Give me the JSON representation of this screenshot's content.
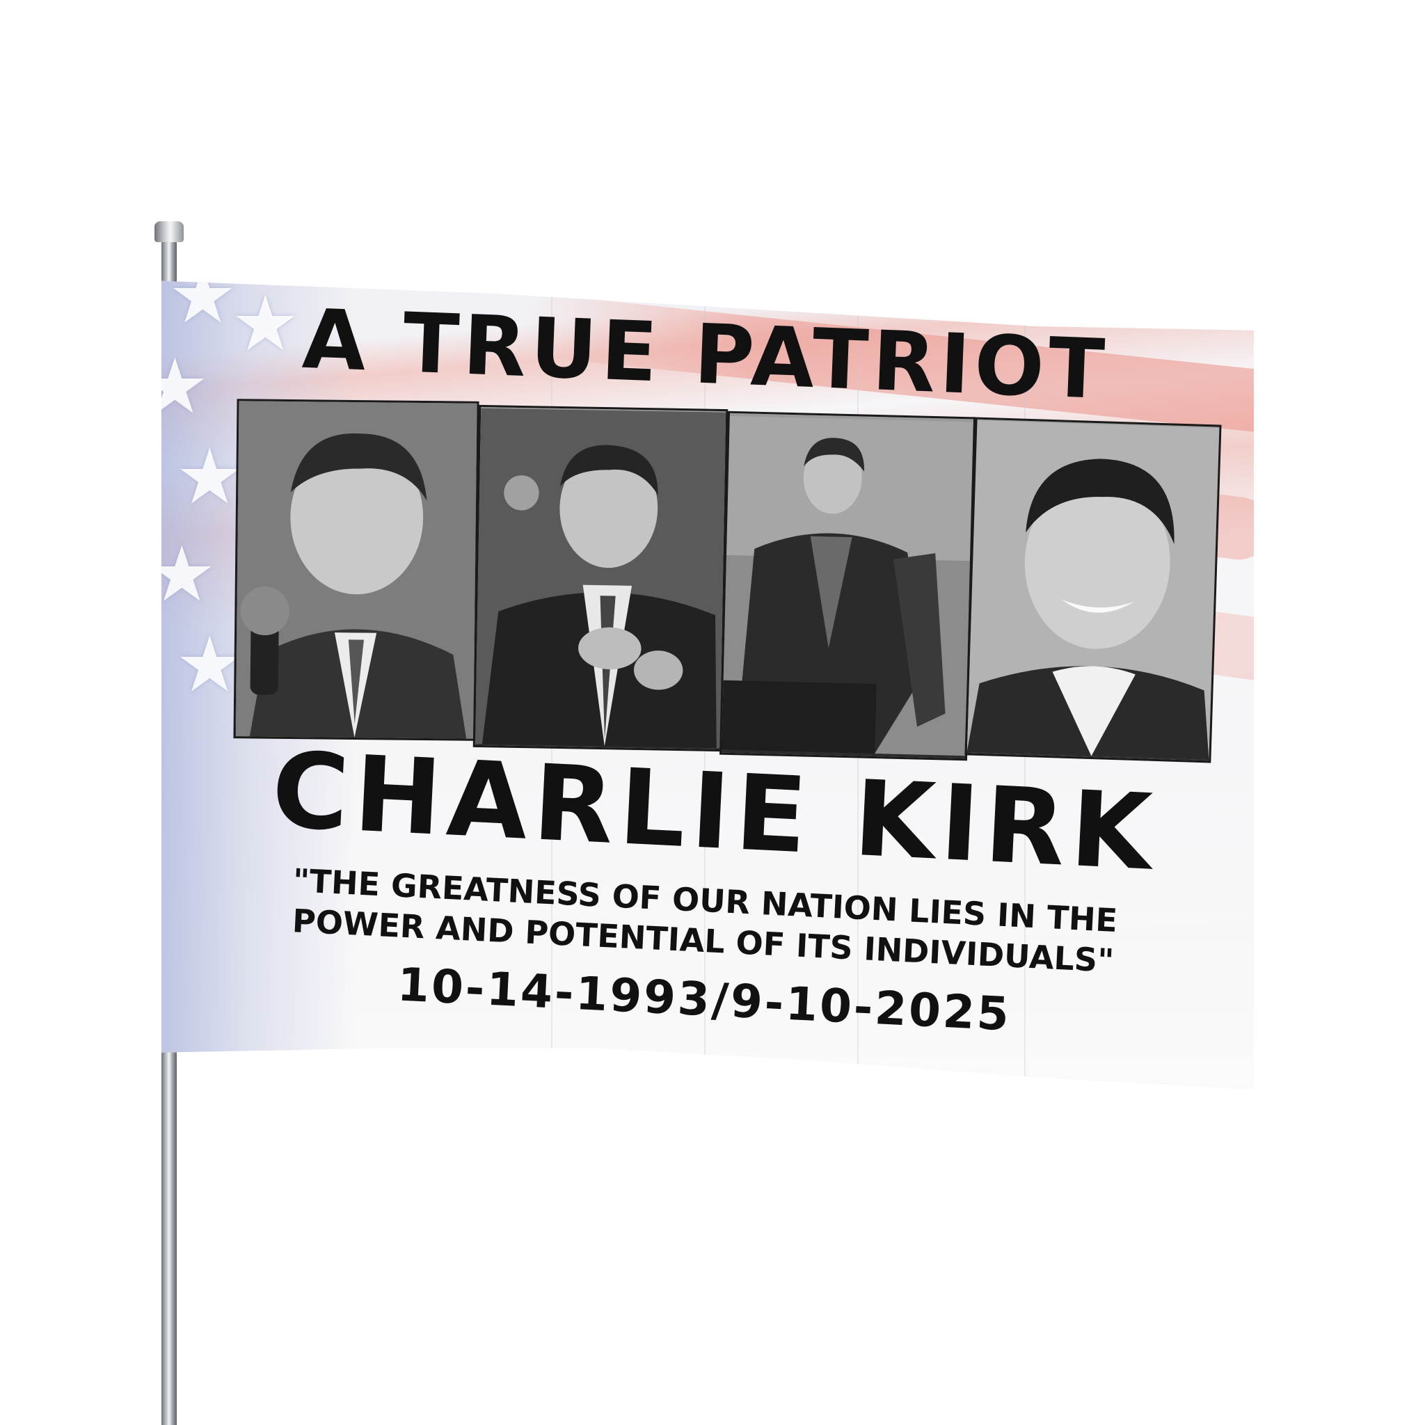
{
  "flag": {
    "title": "A TRUE PATRIOT",
    "name": "CHARLIE KIRK",
    "quote_line1": "\"THE GREATNESS OF OUR NATION LIES IN THE",
    "quote_line2": "POWER AND POTENTIAL OF ITS INDIVIDUALS\"",
    "dates": "10-14-1993/9-10-2025"
  },
  "colors": {
    "text": "#111111",
    "stripe_red": "#ec968c",
    "canton_blue": "#aab4dc",
    "pole": "#c9ccd0"
  },
  "photos": [
    {
      "icon": "portrait-with-microphone"
    },
    {
      "icon": "portrait-clapping"
    },
    {
      "icon": "portrait-seated"
    },
    {
      "icon": "portrait-smiling-headshot"
    }
  ]
}
